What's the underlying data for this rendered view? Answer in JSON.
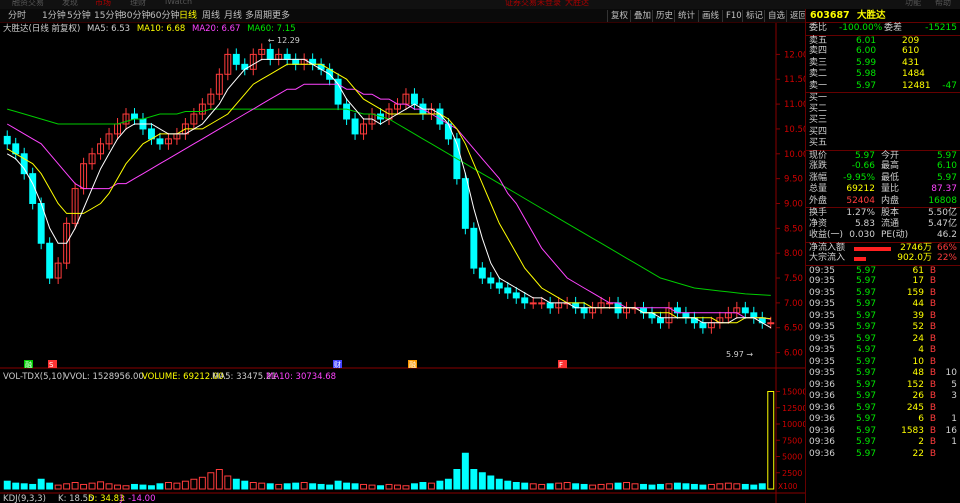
{
  "topbar": {
    "items": [
      "融资交易",
      "发现",
      "市场",
      "理财",
      "iWatch",
      "证券交易未登录",
      "大胜达",
      "功能",
      "帮助"
    ]
  },
  "toolbar": {
    "periods": [
      "分时",
      "1分钟",
      "5分钟",
      "15分钟",
      "30分钟",
      "60分钟",
      "日线",
      "周线",
      "月线",
      "多周期",
      "更多"
    ],
    "active_period": "日线",
    "tools": [
      "复权",
      "叠加",
      "历史",
      "统计",
      "画线",
      "F10",
      "标记",
      "自选",
      "返回"
    ]
  },
  "legend": {
    "name": "大胜达(日线 前复权)",
    "ma5": "MA5: 6.53",
    "ma10": "MA10: 6.68",
    "ma20": "MA20: 6.67",
    "ma60": "MA60: 7.15"
  },
  "vol_legend": {
    "name": "VOL-TDX(5,10)",
    "vvol": "VVOL: 1528956.00",
    "volume": "VOLUME: 69212.00",
    "ma5": "MA5: 33475.21",
    "ma10": "MA10: 30734.68"
  },
  "kdj_legend": {
    "name": "KDJ(9,3,3)",
    "k": "K: 18.55",
    "d": "D: 34.83",
    "j": "J: -14.00"
  },
  "annotations": {
    "high": "12.29",
    "last": "5.97"
  },
  "markers": [
    "融",
    "S",
    "财",
    "融",
    "F"
  ],
  "colors": {
    "up": "#ff3c3c",
    "down": "#00ffff",
    "ma5": "#ffffff",
    "ma10": "#ffff00",
    "ma20": "#ff44ff",
    "ma60": "#00cc00",
    "vvol": "#ffff00"
  },
  "chart_data": [
    {
      "type": "candlestick",
      "yticks": [
        6.0,
        6.5,
        7.0,
        7.5,
        8.0,
        8.5,
        9.0,
        9.5,
        10.0,
        10.5,
        11.0,
        11.5,
        12.0
      ],
      "ylim": [
        5.75,
        12.35
      ],
      "close": [
        10.2,
        10.0,
        9.6,
        9.0,
        8.2,
        7.5,
        7.8,
        8.6,
        9.3,
        9.8,
        10.0,
        10.2,
        10.4,
        10.6,
        10.8,
        10.7,
        10.5,
        10.3,
        10.2,
        10.3,
        10.4,
        10.6,
        10.8,
        11.0,
        11.2,
        11.6,
        12.0,
        11.8,
        11.7,
        12.0,
        12.1,
        11.9,
        12.0,
        11.9,
        11.8,
        11.9,
        11.8,
        11.7,
        11.5,
        11.0,
        10.7,
        10.4,
        10.6,
        10.8,
        10.7,
        10.9,
        11.0,
        11.2,
        11.0,
        10.8,
        10.9,
        10.6,
        10.3,
        9.5,
        8.5,
        7.7,
        7.5,
        7.4,
        7.3,
        7.2,
        7.1,
        7.0,
        7.0,
        7.0,
        6.9,
        7.0,
        7.0,
        6.9,
        6.8,
        6.9,
        7.0,
        7.0,
        6.8,
        6.9,
        6.9,
        6.8,
        6.7,
        6.6,
        6.9,
        6.8,
        6.7,
        6.6,
        6.5,
        6.6,
        6.7,
        6.8,
        6.9,
        6.8,
        6.7,
        6.6,
        6.6
      ],
      "ma5": [
        10.0,
        9.9,
        9.7,
        9.4,
        9.0,
        8.5,
        8.2,
        8.2,
        8.5,
        8.9,
        9.3,
        9.7,
        10.0,
        10.3,
        10.5,
        10.6,
        10.6,
        10.6,
        10.5,
        10.4,
        10.4,
        10.4,
        10.5,
        10.6,
        10.8,
        11.0,
        11.3,
        11.5,
        11.7,
        11.8,
        11.9,
        11.9,
        11.9,
        11.9,
        11.9,
        11.9,
        11.8,
        11.7,
        11.6,
        11.4,
        11.1,
        10.9,
        10.7,
        10.7,
        10.6,
        10.7,
        10.8,
        10.9,
        11.0,
        10.9,
        10.9,
        10.8,
        10.6,
        10.2,
        9.6,
        8.9,
        8.3,
        7.8,
        7.5,
        7.4,
        7.3,
        7.2,
        7.1,
        7.1,
        7.0,
        7.0,
        7.0,
        6.9,
        6.9,
        6.9,
        6.9,
        6.9,
        6.9,
        6.9,
        6.9,
        6.8,
        6.8,
        6.7,
        6.7,
        6.7,
        6.7,
        6.7,
        6.6,
        6.6,
        6.6,
        6.6,
        6.7,
        6.7,
        6.7,
        6.6,
        6.5
      ],
      "ma10": [
        10.1,
        10.0,
        9.9,
        9.8,
        9.6,
        9.3,
        9.0,
        8.8,
        8.8,
        8.8,
        8.9,
        9.0,
        9.2,
        9.5,
        9.8,
        10.0,
        10.2,
        10.3,
        10.4,
        10.4,
        10.4,
        10.5,
        10.5,
        10.5,
        10.6,
        10.7,
        10.8,
        11.0,
        11.2,
        11.4,
        11.5,
        11.6,
        11.7,
        11.8,
        11.8,
        11.8,
        11.8,
        11.8,
        11.7,
        11.6,
        11.5,
        11.3,
        11.1,
        11.0,
        10.9,
        10.8,
        10.8,
        10.8,
        10.8,
        10.8,
        10.8,
        10.8,
        10.7,
        10.5,
        10.2,
        9.8,
        9.4,
        9.0,
        8.6,
        8.3,
        8.0,
        7.7,
        7.5,
        7.3,
        7.2,
        7.1,
        7.0,
        7.0,
        7.0,
        6.9,
        6.9,
        6.9,
        6.9,
        6.9,
        6.9,
        6.8,
        6.8,
        6.8,
        6.8,
        6.7,
        6.7,
        6.7,
        6.7,
        6.7,
        6.6,
        6.6,
        6.6,
        6.7,
        6.7,
        6.7,
        6.68
      ],
      "ma20": [
        10.6,
        10.5,
        10.4,
        10.3,
        10.2,
        10.0,
        9.8,
        9.6,
        9.4,
        9.3,
        9.3,
        9.3,
        9.3,
        9.4,
        9.4,
        9.5,
        9.6,
        9.7,
        9.8,
        9.9,
        10.0,
        10.1,
        10.2,
        10.3,
        10.4,
        10.5,
        10.6,
        10.7,
        10.8,
        10.9,
        11.0,
        11.1,
        11.2,
        11.3,
        11.3,
        11.4,
        11.4,
        11.4,
        11.4,
        11.4,
        11.3,
        11.3,
        11.2,
        11.2,
        11.1,
        11.1,
        11.0,
        11.0,
        10.9,
        10.9,
        10.8,
        10.7,
        10.6,
        10.5,
        10.3,
        10.1,
        9.9,
        9.7,
        9.5,
        9.2,
        9.0,
        8.7,
        8.4,
        8.1,
        7.9,
        7.7,
        7.5,
        7.4,
        7.3,
        7.2,
        7.1,
        7.0,
        7.0,
        6.9,
        6.9,
        6.9,
        6.9,
        6.9,
        6.9,
        6.8,
        6.8,
        6.8,
        6.8,
        6.8,
        6.8,
        6.8,
        6.8,
        6.7,
        6.7,
        6.7,
        6.67
      ],
      "ma60": [
        10.9,
        10.85,
        10.8,
        10.75,
        10.7,
        10.65,
        10.6,
        10.6,
        10.6,
        10.6,
        10.6,
        10.6,
        10.6,
        10.6,
        10.65,
        10.7,
        10.7,
        10.75,
        10.8,
        10.8,
        10.8,
        10.85,
        10.85,
        10.85,
        10.9,
        10.9,
        10.9,
        10.9,
        10.9,
        10.9,
        10.9,
        10.9,
        10.9,
        10.9,
        10.9,
        10.9,
        10.9,
        10.9,
        10.9,
        10.9,
        10.9,
        10.85,
        10.8,
        10.8,
        10.75,
        10.7,
        10.6,
        10.5,
        10.4,
        10.3,
        10.2,
        10.1,
        10.0,
        9.9,
        9.8,
        9.7,
        9.6,
        9.5,
        9.4,
        9.3,
        9.2,
        9.1,
        9.0,
        8.9,
        8.8,
        8.7,
        8.6,
        8.5,
        8.4,
        8.3,
        8.2,
        8.1,
        8.0,
        7.9,
        7.8,
        7.7,
        7.6,
        7.5,
        7.45,
        7.4,
        7.35,
        7.3,
        7.28,
        7.26,
        7.24,
        7.22,
        7.2,
        7.18,
        7.17,
        7.16,
        7.15
      ]
    },
    {
      "type": "bar",
      "yticks": [
        2500,
        5000,
        7500,
        10000,
        12500,
        15000
      ],
      "ylim": [
        0,
        16000
      ],
      "last_label": "X100",
      "values": [
        1200,
        900,
        800,
        700,
        1500,
        900,
        600,
        800,
        1000,
        700,
        900,
        1100,
        800,
        600,
        500,
        700,
        600,
        500,
        800,
        1000,
        900,
        1200,
        1500,
        1800,
        2500,
        3000,
        2000,
        1500,
        1200,
        1000,
        900,
        800,
        700,
        800,
        900,
        1000,
        800,
        700,
        600,
        1200,
        900,
        800,
        700,
        600,
        500,
        700,
        600,
        500,
        800,
        1000,
        900,
        1200,
        1500,
        3000,
        5500,
        3000,
        2500,
        2000,
        1500,
        1200,
        1000,
        900,
        800,
        700,
        800,
        900,
        1000,
        800,
        700,
        600,
        700,
        800,
        900,
        1000,
        800,
        700,
        600,
        700,
        800,
        900,
        800,
        700,
        600,
        700,
        800,
        900,
        800,
        700,
        600,
        800,
        15000
      ]
    }
  ],
  "quote": {
    "code": "603687",
    "name": "大胜达",
    "weibi": {
      "label": "委比",
      "value": "-100.00%",
      "diff_label": "委差",
      "diff": "-15215"
    },
    "asks": [
      {
        "label": "卖五",
        "price": "6.01",
        "vol": "209"
      },
      {
        "label": "卖四",
        "price": "6.00",
        "vol": "610"
      },
      {
        "label": "卖三",
        "price": "5.99",
        "vol": "431"
      },
      {
        "label": "卖二",
        "price": "5.98",
        "vol": "1484"
      },
      {
        "label": "卖一",
        "price": "5.97",
        "vol": "12481",
        "extra": "-47"
      }
    ],
    "bids": [
      {
        "label": "买一"
      },
      {
        "label": "买二"
      },
      {
        "label": "买三"
      },
      {
        "label": "买四"
      },
      {
        "label": "买五"
      }
    ],
    "stats": [
      {
        "l1": "现价",
        "v1": "5.97",
        "l2": "今开",
        "v2": "5.97",
        "c1": "g",
        "c2": "g"
      },
      {
        "l1": "涨跌",
        "v1": "-0.66",
        "l2": "最高",
        "v2": "6.10",
        "c1": "g",
        "c2": "g"
      },
      {
        "l1": "涨幅",
        "v1": "-9.95%",
        "l2": "最低",
        "v2": "5.97",
        "c1": "g",
        "c2": "g"
      },
      {
        "l1": "总量",
        "v1": "69212",
        "l2": "量比",
        "v2": "87.37",
        "c1": "y",
        "c2": "m"
      },
      {
        "l1": "外盘",
        "v1": "52404",
        "l2": "内盘",
        "v2": "16808",
        "c1": "r",
        "c2": "g"
      }
    ],
    "stats2": [
      {
        "l1": "换手",
        "v1": "1.27%",
        "l2": "股本",
        "v2": "5.50亿"
      },
      {
        "l1": "净资",
        "v1": "5.83",
        "l2": "流通",
        "v2": "5.47亿"
      },
      {
        "l1": "收益(一)",
        "v1": "0.030",
        "l2": "PE(动)",
        "v2": "46.2"
      }
    ],
    "flow": [
      {
        "label": "净流入额",
        "value": "2746万",
        "pct": "66%",
        "bar": 0.66
      },
      {
        "label": "大宗流入",
        "value": "902.0万",
        "pct": "22%",
        "bar": 0.22
      }
    ],
    "ticks": [
      [
        "09:35",
        "5.97",
        "61",
        "B"
      ],
      [
        "09:35",
        "5.97",
        "17",
        "B"
      ],
      [
        "09:35",
        "5.97",
        "159",
        "B"
      ],
      [
        "09:35",
        "5.97",
        "44",
        "B"
      ],
      [
        "09:35",
        "5.97",
        "39",
        "B"
      ],
      [
        "09:35",
        "5.97",
        "52",
        "B"
      ],
      [
        "09:35",
        "5.97",
        "24",
        "B"
      ],
      [
        "09:35",
        "5.97",
        "4",
        "B"
      ],
      [
        "09:35",
        "5.97",
        "10",
        "B"
      ],
      [
        "09:35",
        "5.97",
        "48",
        "B"
      ],
      [
        "09:36",
        "5.97",
        "152",
        "B"
      ],
      [
        "09:36",
        "5.97",
        "26",
        "B"
      ],
      [
        "09:36",
        "5.97",
        "245",
        "B"
      ],
      [
        "09:36",
        "5.97",
        "6",
        "B"
      ],
      [
        "09:36",
        "5.97",
        "1583",
        "B"
      ],
      [
        "09:36",
        "5.97",
        "2",
        "B"
      ],
      [
        "09:36",
        "5.97",
        "22",
        "B"
      ]
    ],
    "tick_extra": [
      "",
      "",
      "",
      "",
      "",
      "",
      "",
      "",
      "",
      "10",
      "5",
      "3",
      "",
      "1",
      "16",
      "1",
      ""
    ]
  }
}
